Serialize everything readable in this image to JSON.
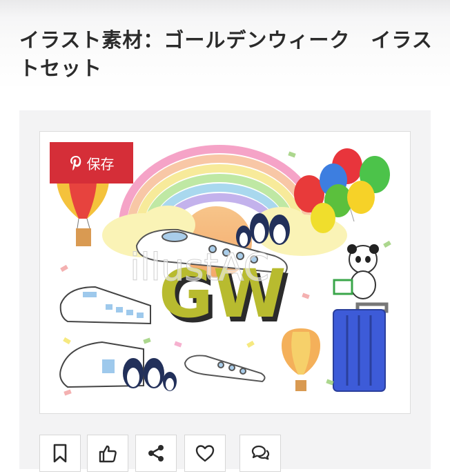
{
  "page": {
    "title": "イラスト素材：ゴールデンウィーク　イラストセット"
  },
  "illustration": {
    "watermark": "illustAC",
    "center_text": "GW",
    "save_label": "保存",
    "save_icon": "pinterest-icon"
  },
  "actions": [
    {
      "icon": "bookmark-icon"
    },
    {
      "icon": "thumbs-up-icon"
    },
    {
      "icon": "share-icon"
    },
    {
      "icon": "heart-icon"
    },
    {
      "icon": "comment-icon"
    }
  ],
  "colors": {
    "save_button": "#d52e38",
    "title_text": "#2b2b2b",
    "icon_stroke": "#2b2b2b"
  }
}
